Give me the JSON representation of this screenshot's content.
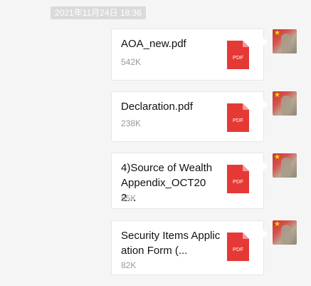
{
  "chat": {
    "timestamp": "2021年11月24日 18:36"
  },
  "messages": [
    {
      "file_name": "AOA_new.pdf",
      "file_size": "542K",
      "icon_label": "PDF"
    },
    {
      "file_name": "Declaration.pdf",
      "file_size": "238K",
      "icon_label": "PDF"
    },
    {
      "file_name": "4)Source of Wealth Appendix_OCT202...",
      "file_size": "85K",
      "icon_label": "PDF"
    },
    {
      "file_name": "Security Items Application Form (...",
      "file_size": "82K",
      "icon_label": "PDF"
    }
  ],
  "colors": {
    "pdf_red": "#e53935",
    "pdf_fold": "#ef9a9a",
    "background": "#f5f5f5"
  },
  "icons": {
    "file": "pdf-file-icon",
    "avatar_star": "★"
  }
}
